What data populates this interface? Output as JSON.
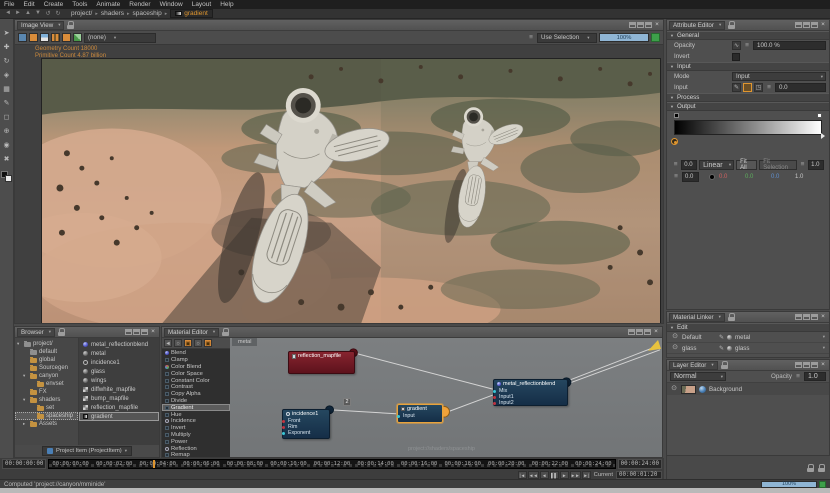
{
  "menu": {
    "items": [
      "File",
      "Edit",
      "Create",
      "Tools",
      "Animate",
      "Render",
      "Window",
      "Layout",
      "Help"
    ]
  },
  "breadcrumb": {
    "path": [
      "project/",
      "shaders",
      "spaceship"
    ],
    "active": "gradient"
  },
  "nav_icons": [
    "◄",
    "►",
    "▲",
    "▼",
    "↺",
    "↻"
  ],
  "left_toolbar": {
    "tools": [
      "➤",
      "✚",
      "↻",
      "◈",
      "▦",
      "✎",
      "◻",
      "⊕",
      "◉",
      "✖"
    ]
  },
  "image_view": {
    "title": "Image View",
    "view_dropdown": "(none)",
    "selection_mode": "Use Selection",
    "render_progress": "100%",
    "overlay": {
      "geometry": "Geometry Count 18000",
      "primitives": "Primitive Count 4.87 billion"
    }
  },
  "attribute_editor": {
    "title": "Attribute Editor",
    "general_section": "General",
    "opacity_label": "Opacity",
    "opacity_value": "100.0 %",
    "invert_label": "Invert",
    "input_section": "Input",
    "mode_label": "Mode",
    "mode_value": "Input",
    "input_label": "Input",
    "input_value": "0.0",
    "process_section": "Process",
    "output_section": "Output",
    "ramp": {
      "min": "0.0",
      "interpolation": "Linear",
      "fit_all": "Fit All",
      "fit_selection": "Fit Selection",
      "max": "1.0",
      "key_position": "0.0",
      "key_r": "0.0",
      "key_g": "0.0",
      "key_b": "0.0",
      "key_a": "1.0"
    }
  },
  "material_linker": {
    "title": "Material Linker",
    "edit_section": "Edit",
    "rows": [
      {
        "slot": "Default",
        "material": "metal"
      },
      {
        "slot": "glass",
        "material": "glass"
      }
    ]
  },
  "layer_editor": {
    "title": "Layer Editor",
    "blend_mode": "Normal",
    "opacity_label": "Opacity",
    "opacity_value": "1.0",
    "layers": [
      {
        "name": "Background"
      }
    ]
  },
  "browser": {
    "title": "Browser",
    "tree": [
      {
        "label": "project/",
        "cls": "d0 exp ctx"
      },
      {
        "label": "default",
        "cls": "d1 ctx"
      },
      {
        "label": "global",
        "cls": "d1"
      },
      {
        "label": "Sourcegen",
        "cls": "d1"
      },
      {
        "label": "canyon",
        "cls": "d1 exp"
      },
      {
        "label": "envset",
        "cls": "d2"
      },
      {
        "label": "FX",
        "cls": "d1"
      },
      {
        "label": "shaders",
        "cls": "d1 exp"
      },
      {
        "label": "set",
        "cls": "d2"
      },
      {
        "label": "spaceship",
        "cls": "d2 sel"
      },
      {
        "label": "Assets",
        "cls": "d1 col"
      }
    ],
    "items": [
      {
        "label": "metal_reflectionblend",
        "cls": "i-sphere-p"
      },
      {
        "label": "metal",
        "cls": "i-sphere-d"
      },
      {
        "label": "incidence1",
        "cls": "i-circ"
      },
      {
        "label": "glass",
        "cls": "i-sphere-d"
      },
      {
        "label": "wings",
        "cls": "i-sphere-d"
      },
      {
        "label": "diffwhite_mapfile",
        "cls": "i-map"
      },
      {
        "label": "bump_mapfile",
        "cls": "i-map"
      },
      {
        "label": "reflection_mapfile",
        "cls": "i-map"
      },
      {
        "label": "gradient",
        "cls": "i-grad sel"
      }
    ],
    "type_filter": "Project Item (ProjectItem)"
  },
  "material_editor": {
    "title": "Material Editor",
    "toolbar": [
      "◄",
      "○",
      "▣",
      "○",
      "▣"
    ],
    "graph_tab": "metal",
    "watermark": "project://shaders/spaceship",
    "node_types": [
      {
        "label": "Blend",
        "cls": "ic-sph"
      },
      {
        "label": "Clamp"
      },
      {
        "label": "Color Blend",
        "cls": "ic-sph2"
      },
      {
        "label": "Color Space"
      },
      {
        "label": "Constant Color"
      },
      {
        "label": "Contrast"
      },
      {
        "label": "Copy Alpha"
      },
      {
        "label": "Divide"
      },
      {
        "label": "Gradient",
        "cls": "sel"
      },
      {
        "label": "Hue"
      },
      {
        "label": "Incidence",
        "cls": "ic-ring"
      },
      {
        "label": "Invert"
      },
      {
        "label": "Multiply"
      },
      {
        "label": "Power"
      },
      {
        "label": "Reflection",
        "cls": "ic-ring"
      },
      {
        "label": "Remap"
      }
    ],
    "nodes": {
      "mapfile": {
        "title": "reflection_mapfile"
      },
      "incidence": {
        "title": "incidence1",
        "badge": "2",
        "ports": [
          {
            "label": "Front",
            "cls": "p-red"
          },
          {
            "label": "Rim",
            "cls": "p-red"
          },
          {
            "label": "Exponent",
            "cls": "p-cyan"
          }
        ]
      },
      "gradient": {
        "title": "gradient",
        "ports": [
          {
            "label": "Input",
            "cls": "p-cyan"
          }
        ]
      },
      "blend": {
        "title": "metal_reflectionblend",
        "ports": [
          {
            "label": "Mix",
            "cls": "p-cyan"
          },
          {
            "label": "Input1",
            "cls": "p-red"
          },
          {
            "label": "Input2",
            "cls": "p-red"
          }
        ]
      }
    }
  },
  "timeline": {
    "start": "00:00:00:00",
    "end": "00:00:24:00",
    "ticks": [
      "00:00:00:00",
      "00:00:02:00",
      "00:00:04:00",
      "00:00:06:00",
      "00:00:08:00",
      "00:00:10:00",
      "00:00:12:00",
      "00:00:14:00",
      "00:00:16:00",
      "00:00:18:00",
      "00:00:20:00",
      "00:00:22:00",
      "00:00:24:00"
    ],
    "transport": [
      "|◄",
      "◄◄",
      "◄",
      "▌▌",
      "►",
      "►►",
      "►|"
    ],
    "current_label": "Current",
    "current_value": "00:00:01:20"
  },
  "status_bar": {
    "message": "Computed 'project://canyon/mminide'",
    "progress": "100%"
  },
  "colors": {
    "accent_orange": "#e0962f",
    "node_blue": "#1d3a52",
    "node_red": "#6e1722",
    "progress_blue": "#8fb5d4",
    "confirm_green": "#3da04a"
  }
}
